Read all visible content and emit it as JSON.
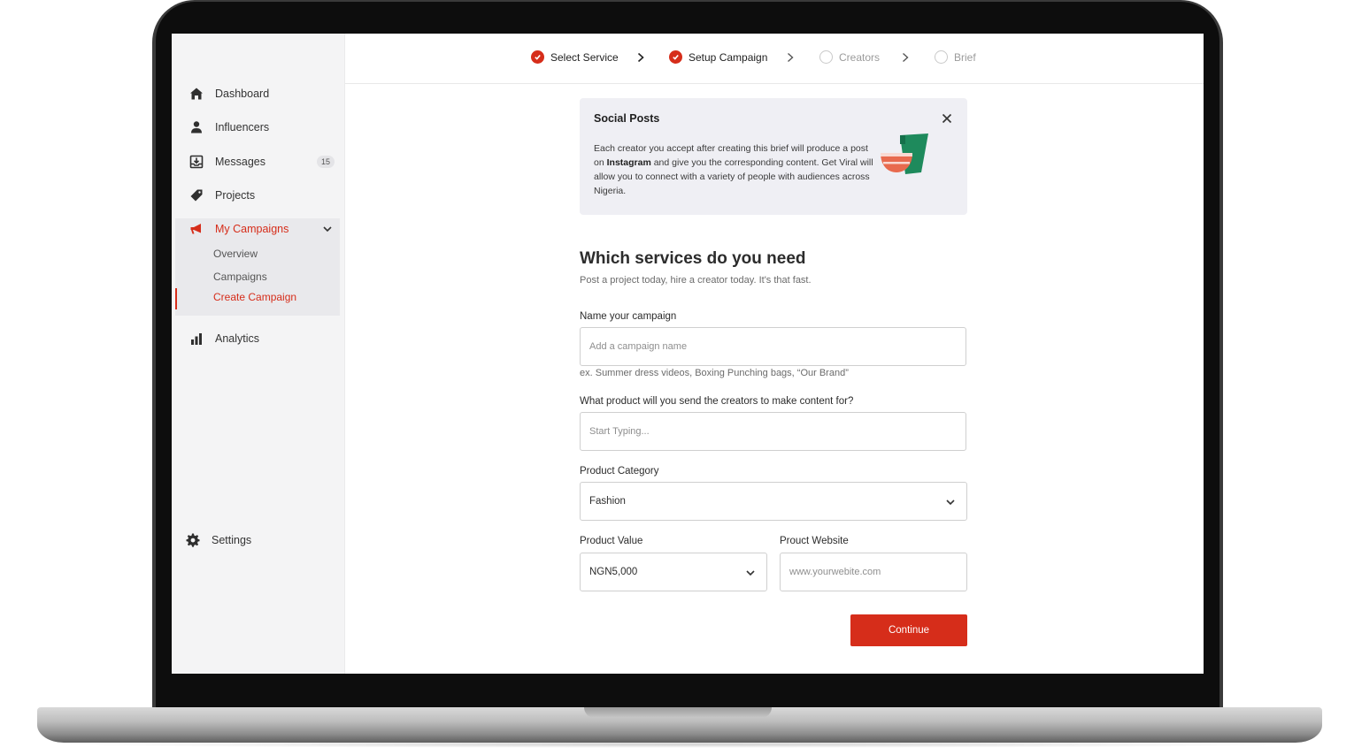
{
  "sidebar": {
    "items": [
      {
        "label": "Dashboard",
        "icon": "home-icon"
      },
      {
        "label": "Influencers",
        "icon": "user-icon"
      },
      {
        "label": "Messages",
        "icon": "inbox-icon",
        "badge": "15"
      },
      {
        "label": "Projects",
        "icon": "tag-icon"
      },
      {
        "label": "My Campaigns",
        "icon": "megaphone-icon"
      },
      {
        "label": "Analytics",
        "icon": "bar-chart-icon"
      },
      {
        "label": "Settings",
        "icon": "gear-icon"
      }
    ],
    "campaigns_sub": [
      "Overview",
      "Campaigns",
      "Create Campaign"
    ],
    "active_sub": "Create Campaign"
  },
  "stepper": {
    "steps": [
      {
        "label": "Select Service",
        "status": "done"
      },
      {
        "label": "Setup Campaign",
        "status": "done"
      },
      {
        "label": "Creators",
        "status": "todo"
      },
      {
        "label": "Brief",
        "status": "todo"
      }
    ]
  },
  "info_card": {
    "title": "Social Posts",
    "text_before": "Each creator you accept after creating this brief will produce a post on ",
    "text_bold": "Instagram",
    "text_after": " and give you the corresponding content. Get Viral will allow you to connect with a variety of people with audiences across Nigeria."
  },
  "form": {
    "title": "Which services do you need",
    "subtitle": "Post a project today, hire a creator today. It's that fast.",
    "campaign_name": {
      "label": "Name your campaign",
      "placeholder": "Add a campaign name",
      "hint": "ex. Summer dress videos, Boxing Punching bags, “Our Brand”"
    },
    "product": {
      "label": "What product will you send the creators to make content for?",
      "placeholder": "Start Typing..."
    },
    "category": {
      "label": "Product Category",
      "value": "Fashion"
    },
    "value": {
      "label": "Product Value",
      "value": "NGN5,000"
    },
    "website": {
      "label": "Prouct Website",
      "placeholder": "www.yourwebite.com"
    },
    "continue_label": "Continue"
  },
  "colors": {
    "accent": "#d62d1a",
    "sidebar_bg": "#f4f4f5",
    "card_bg": "#efeff4"
  }
}
